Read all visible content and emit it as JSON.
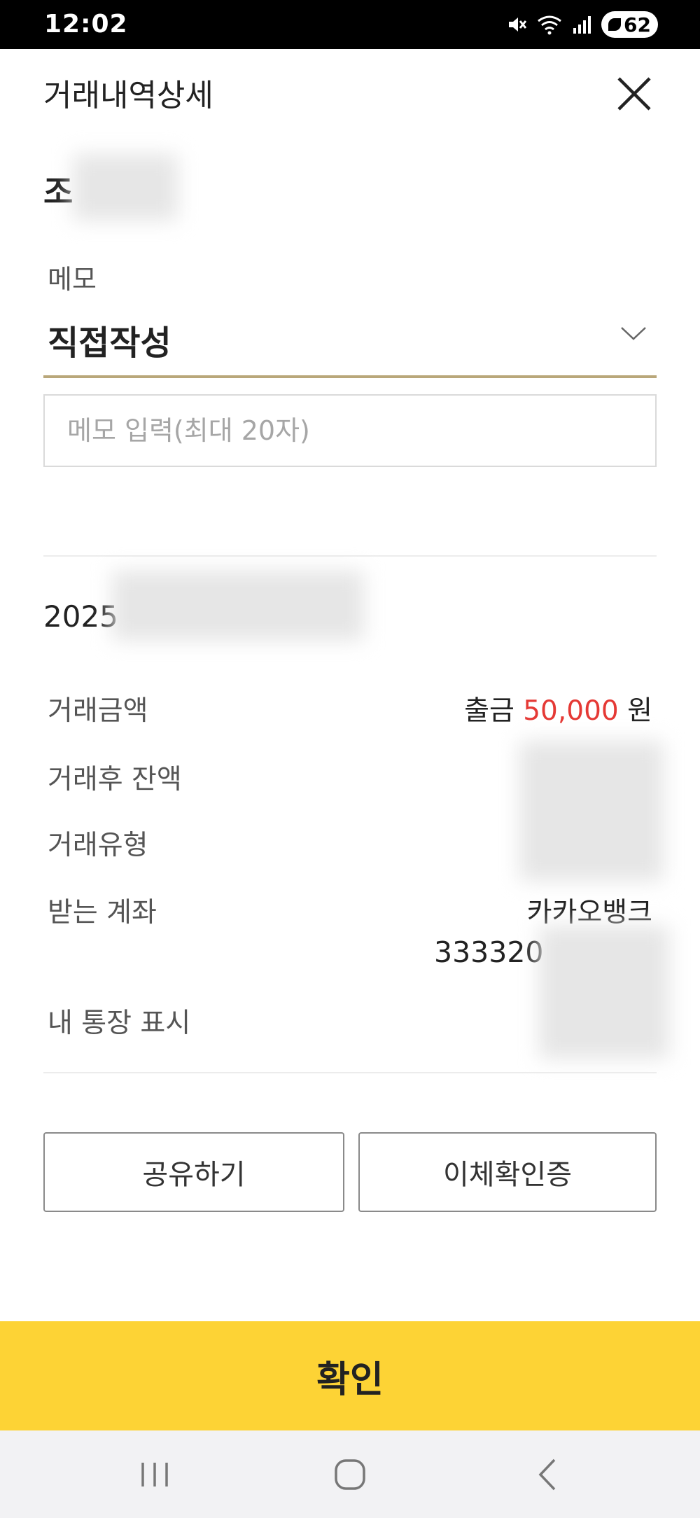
{
  "status_bar": {
    "time": "12:02",
    "battery_level": "62",
    "icons": [
      "mute-icon",
      "wifi-icon",
      "signal-icon",
      "battery-icon"
    ]
  },
  "header": {
    "title": "거래내역상세",
    "close_icon": "close-icon"
  },
  "payee": {
    "name_prefix": "조"
  },
  "memo": {
    "label": "메모",
    "selected_option": "직접작성",
    "input_placeholder": "메모 입력(최대 20자)",
    "input_value": ""
  },
  "transaction": {
    "date_prefix": "2025",
    "rows": [
      {
        "label": "거래금액",
        "type_text": "출금",
        "amount": "50,000",
        "unit": "원"
      },
      {
        "label": "거래후 잔액"
      },
      {
        "label": "거래유형"
      },
      {
        "label": "받는 계좌",
        "bank": "카카오뱅크",
        "account_prefix": "333320"
      },
      {
        "label": "내 통장 표시"
      }
    ]
  },
  "buttons": {
    "share": "공유하기",
    "transfer_certificate": "이체확인증",
    "confirm": "확인"
  },
  "colors": {
    "accent_yellow": "#fdd335",
    "underline_gold": "#b9a77a",
    "amount_red": "#e53935"
  }
}
